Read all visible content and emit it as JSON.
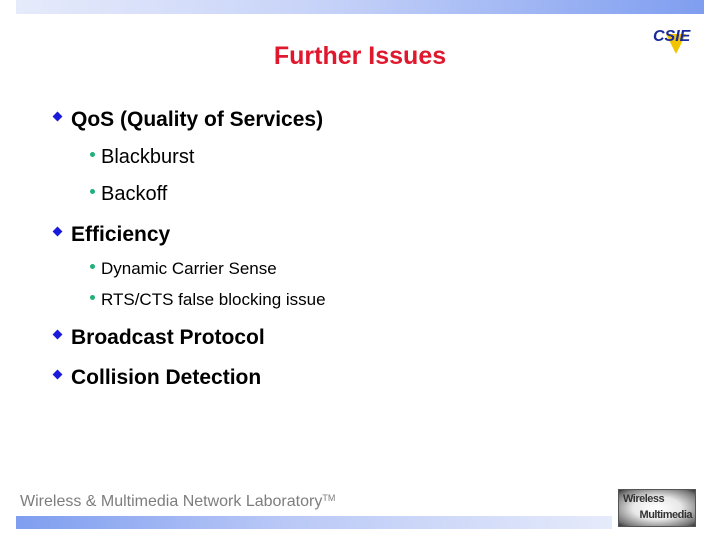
{
  "slide": {
    "title": "Further Issues",
    "bullets": [
      {
        "text": "QoS (Quality of Services)",
        "children": [
          "Blackburst",
          "Backoff"
        ]
      },
      {
        "text": "Efficiency",
        "children": [
          "Dynamic Carrier Sense",
          "RTS/CTS false blocking issue"
        ]
      },
      {
        "text": "Broadcast Protocol",
        "children": []
      },
      {
        "text": "Collision Detection",
        "children": []
      }
    ]
  },
  "footer": {
    "lab_name": "Wireless & Multimedia Network Laboratory",
    "trademark": "TM"
  },
  "logos": {
    "csie": {
      "text": "CSIE",
      "colors": {
        "letters": "#1a2a9c",
        "accent": "#f2c400"
      }
    },
    "wireless_multimedia": {
      "line1": "Wireless",
      "line2": "Multimedia"
    }
  },
  "colors": {
    "title": "#e0182e",
    "level1_bullet": "#1a1adc",
    "level2_bullet": "#21b07a",
    "footer_text": "#7d7d7d"
  }
}
